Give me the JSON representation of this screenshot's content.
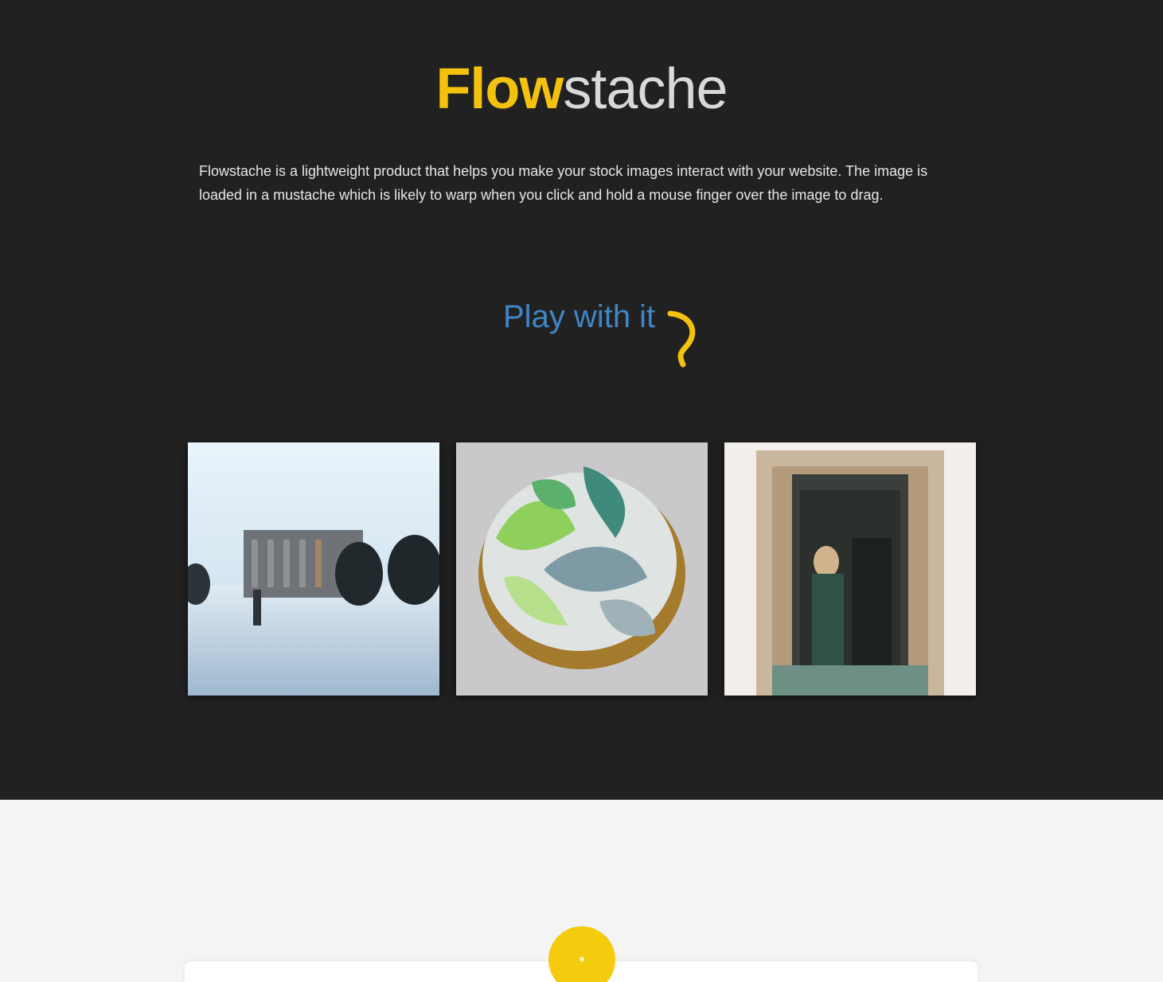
{
  "brand": {
    "name_part1": "Flow",
    "name_part2": "stache",
    "accent_color": "#f4c20d"
  },
  "hero": {
    "description": "Flowstache is a lightweight product that helps you make your stock images interact with your website. The image is loaded in a mustache which is likely to warp when you click and hold a mouse finger over the image to drag.",
    "play_link": "Play with it",
    "play_link_color": "#3f86c7",
    "play_arrow_icon": "curved-arrow-down-icon"
  },
  "gallery": {
    "images": [
      {
        "subject": "snowy landscape with building and trees"
      },
      {
        "subject": "cupcake with green and blue swirl frosting"
      },
      {
        "subject": "ornate doorway with person standing"
      }
    ]
  },
  "lower_section": {
    "badge_icon": "yellow-circle-badge-icon",
    "badge_color": "#f4cc0d"
  }
}
